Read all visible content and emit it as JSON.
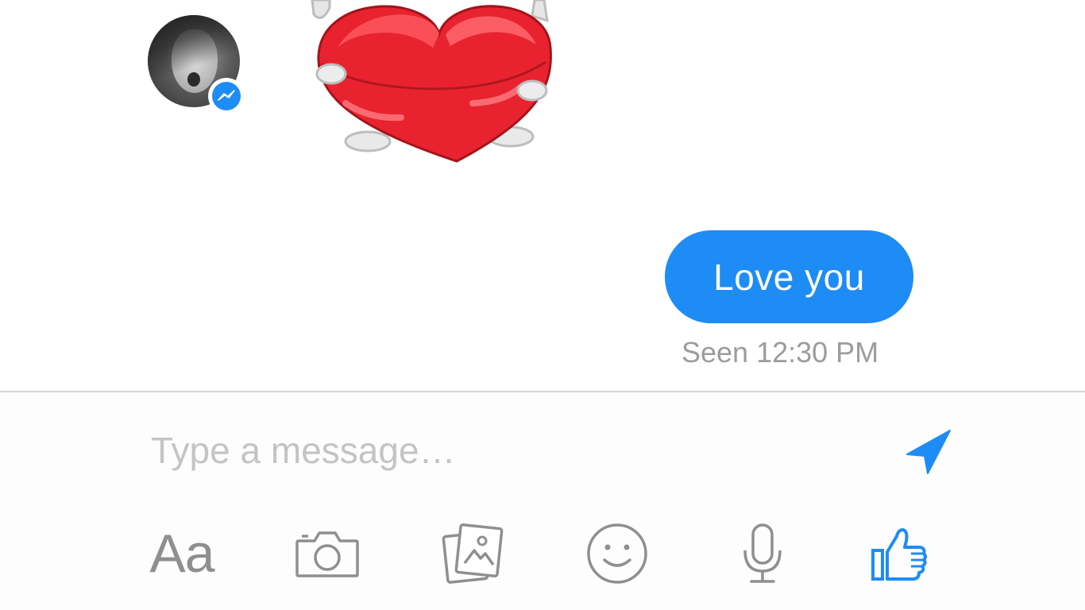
{
  "conversation": {
    "contact_avatar_icon": "contact-avatar",
    "badge_icon": "messenger-bolt-icon",
    "sticker_icon": "heart-sticker",
    "sent_message": {
      "text": "Love you",
      "status": "Seen 12:30 PM"
    }
  },
  "composer": {
    "placeholder": "Type a message…",
    "value": "",
    "send_icon": "send-arrow-icon"
  },
  "toolbar": {
    "items": [
      {
        "label": "Aa",
        "icon": "text-format-icon"
      },
      {
        "icon": "camera-icon"
      },
      {
        "icon": "photo-gallery-icon"
      },
      {
        "icon": "emoji-icon"
      },
      {
        "icon": "microphone-icon"
      },
      {
        "icon": "like-thumb-icon"
      }
    ]
  },
  "colors": {
    "accent": "#1e8cf5",
    "icon_gray": "#8f8f8f",
    "seen_text": "#9c9c9c",
    "placeholder": "#c4c4c4",
    "divider": "#d6d6d6"
  }
}
